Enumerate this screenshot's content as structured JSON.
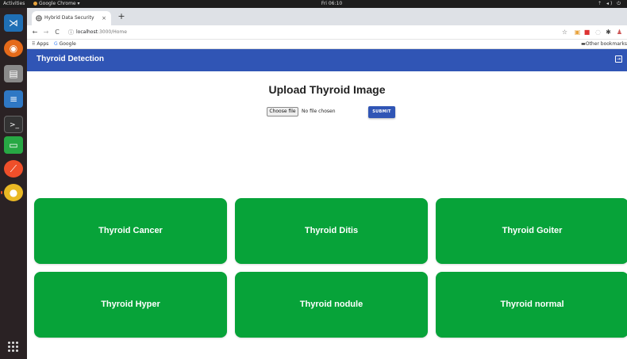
{
  "desktop": {
    "activities": "Activities",
    "chrome_menu": "Google Chrome ▾",
    "clock": "Fri 06:10",
    "tray": "⇡ ◂) ⏻"
  },
  "browser": {
    "tab_title": "Hybrid Data Security",
    "tab_close": "×",
    "new_tab": "+",
    "back": "←",
    "forward": "→",
    "reload": "C",
    "url_host": "localhost",
    "url_path": ":3000/Home",
    "bookmarks": {
      "apps": "Apps",
      "google": "Google",
      "other": "Other bookmarks"
    }
  },
  "app": {
    "brand": "Thyroid Detection",
    "logout_icon": "⇥"
  },
  "upload": {
    "title": "Upload Thyroid Image",
    "choose_file": "Choose file",
    "no_file": "No file chosen",
    "submit": "SUBMIT"
  },
  "cards": [
    "Thyroid Cancer",
    "Thyroid Ditis",
    "Thyroid Goiter",
    "Thyroid Hyper",
    "Thyroid nodule",
    "Thyroid normal"
  ],
  "colors": {
    "appbar": "#3055b5",
    "card": "#07a339"
  }
}
